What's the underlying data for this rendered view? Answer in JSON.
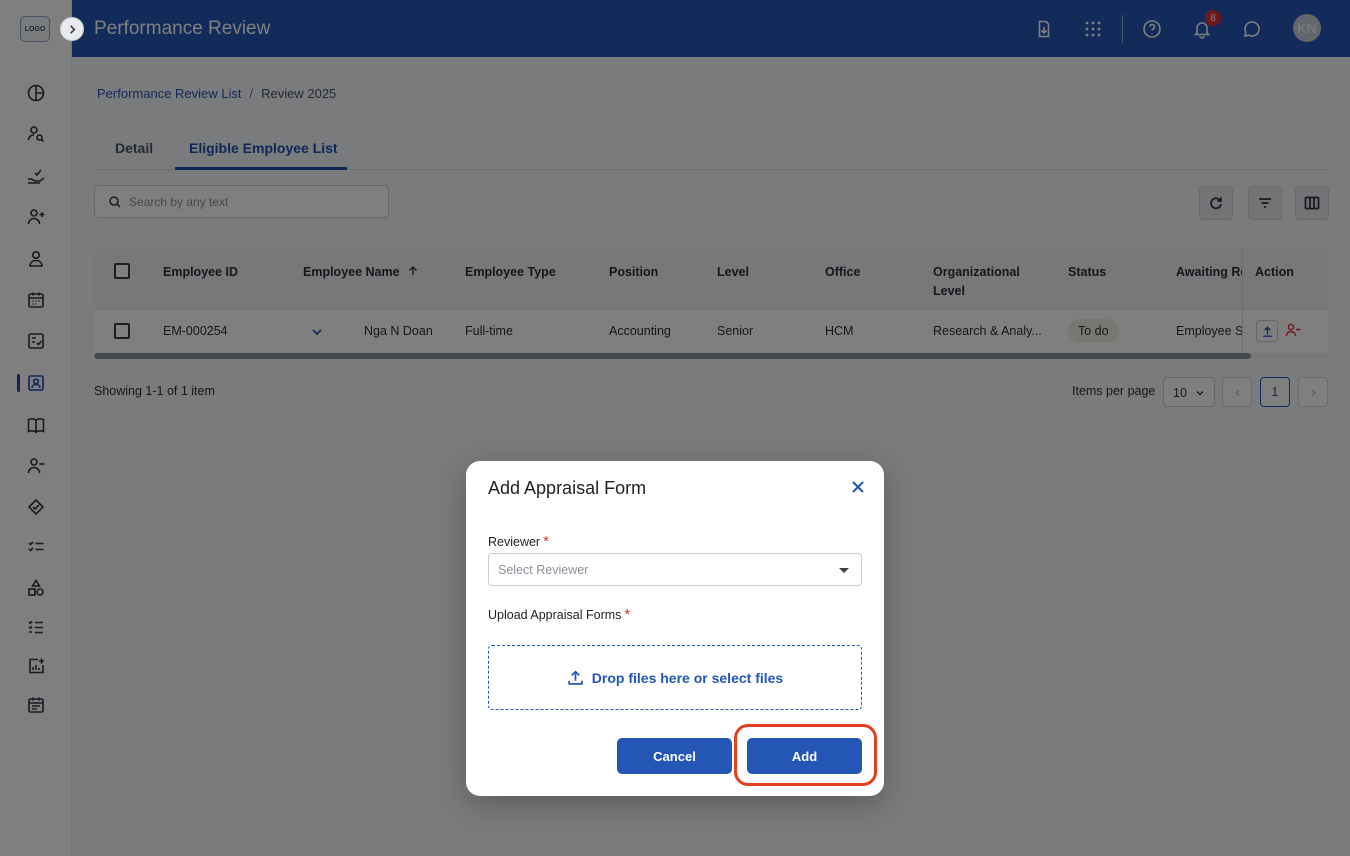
{
  "logo": {
    "text": "LOGO"
  },
  "header": {
    "title": "Performance Review",
    "notification_count": "8",
    "avatar_initials": "KN"
  },
  "breadcrumb": {
    "parent": "Performance Review List",
    "separator": "/",
    "current": "Review 2025"
  },
  "tabs": [
    {
      "label": "Detail",
      "active": false
    },
    {
      "label": "Eligible Employee List",
      "active": true
    }
  ],
  "search": {
    "placeholder": "Search by any text",
    "value": ""
  },
  "table": {
    "headers": [
      "Employee ID",
      "Employee Name",
      "Employee Type",
      "Position",
      "Level",
      "Office",
      "Organizational Level",
      "Status",
      "Awaiting Re",
      "Action"
    ],
    "rows": [
      {
        "employee_id": "EM-000254",
        "employee_name": "Nga N Doan",
        "employee_type": "Full-time",
        "position": "Accounting",
        "level": "Senior",
        "office": "HCM",
        "organizational_level": "Research & Analy...",
        "status": "To do",
        "awaiting": "Employee S"
      }
    ]
  },
  "pagination": {
    "showing": "Showing 1-1 of 1 item",
    "items_per_page_label": "Items per page",
    "items_per_page_value": "10",
    "current_page": "1"
  },
  "modal": {
    "title": "Add Appraisal Form",
    "reviewer_label": "Reviewer",
    "reviewer_placeholder": "Select Reviewer",
    "upload_label": "Upload Appraisal Forms",
    "required_mark": "*",
    "dropzone_text": "Drop files here or select files",
    "cancel_label": "Cancel",
    "add_label": "Add"
  },
  "colors": {
    "header_bg": "#2456b5",
    "primary": "#2456b5",
    "required": "#d93232",
    "highlight_ring": "#e2401f"
  },
  "icons": {
    "header": [
      "file-download-icon",
      "apps-grid-icon",
      "help-icon",
      "bell-icon",
      "chat-icon"
    ],
    "sidebar": [
      "dashboard-icon",
      "user-search-icon",
      "hand-check-icon",
      "user-add-icon",
      "user-icon",
      "calendar-icon",
      "checklist-icon",
      "contact-card-icon",
      "book-icon",
      "user-remove-icon",
      "handshake-icon",
      "task-list-icon",
      "shapes-icon",
      "ordered-list-icon",
      "report-icon",
      "event-note-icon"
    ]
  }
}
